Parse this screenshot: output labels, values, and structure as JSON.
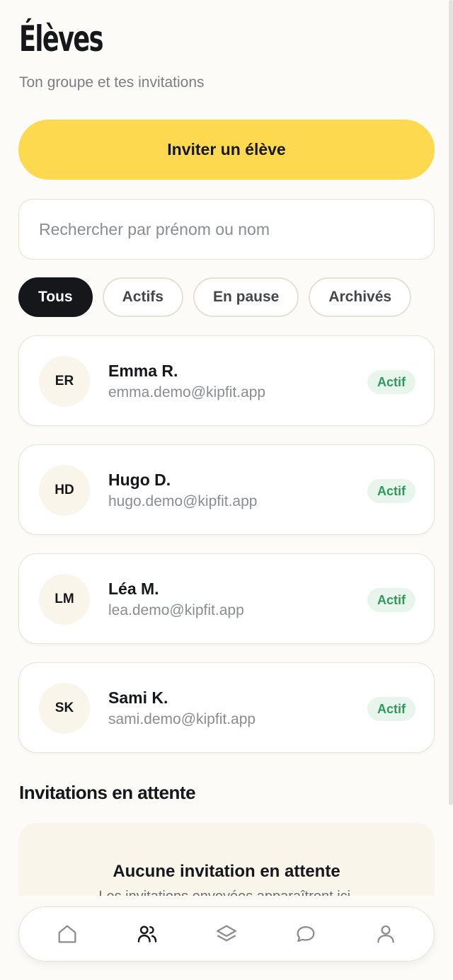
{
  "header": {
    "title": "Élèves",
    "subtitle": "Ton groupe et tes invitations"
  },
  "invite_button": {
    "label": "Inviter un élève"
  },
  "search": {
    "placeholder": "Rechercher par prénom ou nom",
    "value": ""
  },
  "filters": [
    {
      "label": "Tous",
      "active": true
    },
    {
      "label": "Actifs",
      "active": false
    },
    {
      "label": "En pause",
      "active": false
    },
    {
      "label": "Archivés",
      "active": false
    }
  ],
  "students": [
    {
      "initials": "ER",
      "name": "Emma R.",
      "email": "emma.demo@kipfit.app",
      "status": "Actif"
    },
    {
      "initials": "HD",
      "name": "Hugo D.",
      "email": "hugo.demo@kipfit.app",
      "status": "Actif"
    },
    {
      "initials": "LM",
      "name": "Léa M.",
      "email": "lea.demo@kipfit.app",
      "status": "Actif"
    },
    {
      "initials": "SK",
      "name": "Sami K.",
      "email": "sami.demo@kipfit.app",
      "status": "Actif"
    }
  ],
  "pending": {
    "title": "Invitations en attente",
    "empty_title": "Aucune invitation en attente",
    "empty_text": "Les invitations envoyées apparaîtront ici."
  },
  "tabbar": [
    {
      "icon": "home-icon",
      "active": false
    },
    {
      "icon": "users-icon",
      "active": true
    },
    {
      "icon": "layers-icon",
      "active": false
    },
    {
      "icon": "chat-icon",
      "active": false
    },
    {
      "icon": "profile-icon",
      "active": false
    }
  ],
  "colors": {
    "accent": "#fcd94f",
    "dark": "#15171b",
    "active_badge_bg": "#e7f5ec",
    "active_badge_text": "#2e9a5a",
    "background": "#fcfbf8"
  }
}
